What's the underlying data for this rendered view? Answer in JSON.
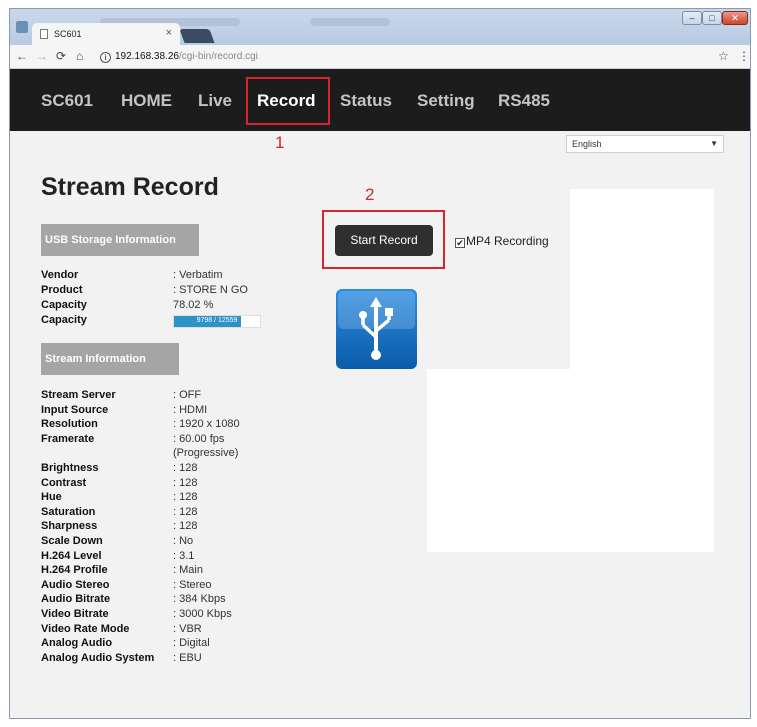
{
  "browser": {
    "tab_title": "SC601",
    "tab_close": "×",
    "url_host": "192.168.38.26",
    "url_path": "/cgi-bin/record.cgi",
    "nav_icons": [
      "back-icon",
      "forward-icon",
      "reload-icon",
      "home-icon"
    ],
    "window_controls": {
      "minimize": "–",
      "maximize": "□",
      "close": "✕"
    }
  },
  "navbar": {
    "items": [
      {
        "label": "SC601"
      },
      {
        "label": "HOME"
      },
      {
        "label": "Live"
      },
      {
        "label": "Record"
      },
      {
        "label": "Status"
      },
      {
        "label": "Setting"
      },
      {
        "label": "RS485"
      }
    ],
    "active": "Record"
  },
  "annotations": {
    "marker1": "1",
    "marker2": "2",
    "color": "#d8242c"
  },
  "language_select": {
    "selected": "English"
  },
  "page_title": "Stream Record",
  "usb_section": {
    "heading": "USB Storage Information",
    "rows": [
      {
        "label": "Vendor",
        "value": ": Verbatim"
      },
      {
        "label": "Product",
        "value": ": STORE N GO"
      },
      {
        "label": "Capacity",
        "value": "78.02 %"
      },
      {
        "label": "Capacity",
        "value": "9798 / 12559"
      }
    ],
    "usage_fraction": 0.78
  },
  "stream_section": {
    "heading": "Stream Information",
    "rows": [
      {
        "label": "Stream Server",
        "value": ": OFF"
      },
      {
        "label": "Input Source",
        "value": ": HDMI"
      },
      {
        "label": "Resolution",
        "value": ": 1920 x 1080"
      },
      {
        "label": "Framerate",
        "value": ": 60.00 fps"
      },
      {
        "label": "",
        "value": "(Progressive)"
      },
      {
        "label": "Brightness",
        "value": ": 128"
      },
      {
        "label": "Contrast",
        "value": ": 128"
      },
      {
        "label": "Hue",
        "value": ": 128"
      },
      {
        "label": "Saturation",
        "value": ": 128"
      },
      {
        "label": "Sharpness",
        "value": ": 128"
      },
      {
        "label": "Scale Down",
        "value": ": No"
      },
      {
        "label": "H.264 Level",
        "value": ": 3.1"
      },
      {
        "label": "H.264 Profile",
        "value": ": Main"
      },
      {
        "label": "Audio Stereo",
        "value": ": Stereo"
      },
      {
        "label": "Audio Bitrate",
        "value": ": 384 Kbps"
      },
      {
        "label": "Video Bitrate",
        "value": ": 3000 Kbps"
      },
      {
        "label": "Video Rate Mode",
        "value": ": VBR"
      },
      {
        "label": "Analog Audio",
        "value": ": Digital"
      },
      {
        "label": "Analog Audio System",
        "value": ": EBU"
      }
    ]
  },
  "record": {
    "start_button": "Start Record",
    "mp4_label": "MP4 Recording",
    "mp4_checked": true
  },
  "colors": {
    "navbar_bg": "#1c1c1c",
    "section_header_bg": "#a5a5a5",
    "progress_fill": "#2f93c8",
    "usb_icon": "#1a6fc2"
  }
}
